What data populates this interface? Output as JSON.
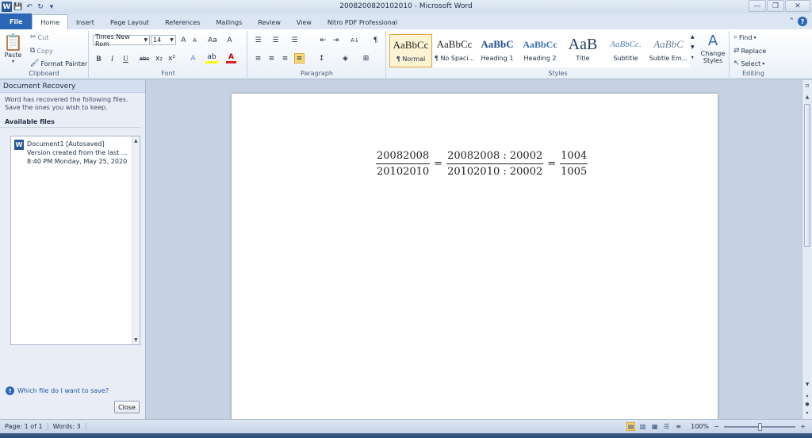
{
  "window": {
    "title": "2008200820102010 - Microsoft Word",
    "minimize": "—",
    "maximize": "❐",
    "close": "✕"
  },
  "qat": {
    "logo": "W",
    "save": "💾",
    "undo": "↶",
    "redo": "↻",
    "customize": "▾"
  },
  "tabs": {
    "file": "File",
    "items": [
      "Home",
      "Insert",
      "Page Layout",
      "References",
      "Mailings",
      "Review",
      "View",
      "Nitro PDF Professional"
    ]
  },
  "ribbon": {
    "clipboard": {
      "label": "Clipboard",
      "paste": "Paste",
      "cut": "Cut",
      "copy": "Copy",
      "format_painter": "Format Painter"
    },
    "font": {
      "label": "Font",
      "font_name": "Times New Rom",
      "font_size": "14",
      "bold": "B",
      "italic": "I",
      "underline": "U",
      "strike": "abc",
      "subscript": "x₂",
      "superscript": "x²",
      "grow": "A",
      "shrink": "A",
      "case": "Aa",
      "clear": "A",
      "text_effects": "A",
      "highlight": "ab",
      "font_color": "A"
    },
    "paragraph": {
      "label": "Paragraph",
      "sort": "A↓",
      "show_marks": "¶"
    },
    "styles": {
      "label": "Styles",
      "tiles": [
        {
          "sample": "AaBbCc",
          "name": "¶ Normal"
        },
        {
          "sample": "AaBbCc",
          "name": "¶ No Spaci..."
        },
        {
          "sample": "AaBbC",
          "name": "Heading 1"
        },
        {
          "sample": "AaBbCc",
          "name": "Heading 2"
        },
        {
          "sample": "AaB",
          "name": "Title"
        },
        {
          "sample": "AaBbCc.",
          "name": "Subtitle"
        },
        {
          "sample": "AaBbC",
          "name": "Subtle Em..."
        }
      ],
      "change_styles": "Change Styles"
    },
    "editing": {
      "label": "Editing",
      "find": "Find",
      "replace": "Replace",
      "select": "Select"
    }
  },
  "recovery": {
    "header": "Document Recovery",
    "description": "Word has recovered the following files.  Save the ones you wish to keep.",
    "available": "Available files",
    "file": {
      "name": "Document1  [Autosaved]",
      "line2": "Version created from the last ...",
      "line3": "8:40 PM Monday, May 25, 2020"
    },
    "help_link": "Which file do I want to save?",
    "close": "Close"
  },
  "document": {
    "f1_num": "20082008",
    "f1_den": "20102010",
    "f2_num": "20082008 : 20002",
    "f2_den": "20102010 : 20002",
    "f3_num": "1004",
    "f3_den": "1005",
    "eq": "="
  },
  "status": {
    "page": "Page: 1 of 1",
    "words": "Words: 3",
    "zoom": "100%",
    "zoom_out": "−",
    "zoom_in": "+"
  },
  "colors": {
    "accent": "#2b67b6",
    "highlight": "#fbd977"
  }
}
